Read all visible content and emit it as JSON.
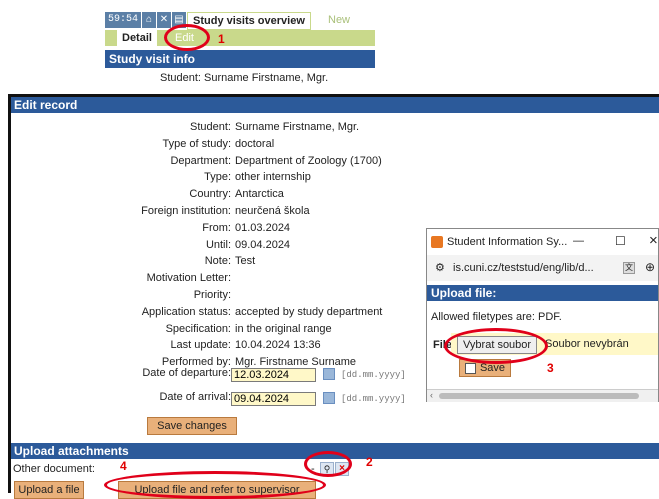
{
  "topbar": {
    "timer": "59:54",
    "home_icon": "home-icon",
    "active_tab": "Study visits overview",
    "new_tab": "New",
    "subtab_detail": "Detail",
    "subtab_edit": "Edit",
    "section_title": "Study visit info",
    "student_line": "Student: Surname Firstname, Mgr."
  },
  "edit": {
    "title": "Edit record",
    "fields": [
      {
        "label": "Student:",
        "value": "Surname Firstname, Mgr."
      },
      {
        "label": "Type of study:",
        "value": "doctoral"
      },
      {
        "label": "Department:",
        "value": "Department of Zoology (1700)"
      },
      {
        "label": "Type:",
        "value": "other internship"
      },
      {
        "label": "Country:",
        "value": "Antarctica"
      },
      {
        "label": "Foreign institution:",
        "value": "neurčená škola"
      },
      {
        "label": "From:",
        "value": "01.03.2024"
      },
      {
        "label": "Until:",
        "value": "09.04.2024"
      },
      {
        "label": "Note:",
        "value": "Test"
      },
      {
        "label": "Motivation Letter:",
        "value": ""
      },
      {
        "label": "Priority:",
        "value": ""
      },
      {
        "label": "Application status:",
        "value": "accepted by study department"
      },
      {
        "label": "Specification:",
        "value": "in the original range"
      },
      {
        "label": "Last update:",
        "value": "10.04.2024 13:36"
      },
      {
        "label": "Performed by:",
        "value": "Mgr. Firstname Surname"
      }
    ],
    "departure_label": "Date of departure:",
    "departure_value": "12.03.2024",
    "arrival_label": "Date of arrival:",
    "arrival_value": "09.04.2024",
    "date_format": "[dd.mm.yyyy]",
    "save_changes": "Save changes"
  },
  "upload": {
    "title": "Upload attachments",
    "other_document": "Other document:",
    "dash": "-",
    "upload_file": "Upload a file",
    "upload_refer": "Upload file and refer to supervisor"
  },
  "popup": {
    "window_title": "Student Information Sy...",
    "minimize": "—",
    "maximize": "☐",
    "close": "×",
    "url": "is.cuni.cz/teststud/eng/lib/d...",
    "header": "Upload file:",
    "allowed": "Allowed filetypes are: PDF.",
    "file_label": "File:",
    "choose_btn": "Vybrat soubor",
    "no_file": "Soubor nevybrán",
    "save": "Save"
  },
  "annotations": {
    "n1": "1",
    "n2": "2",
    "n3": "3",
    "n4": "4"
  }
}
